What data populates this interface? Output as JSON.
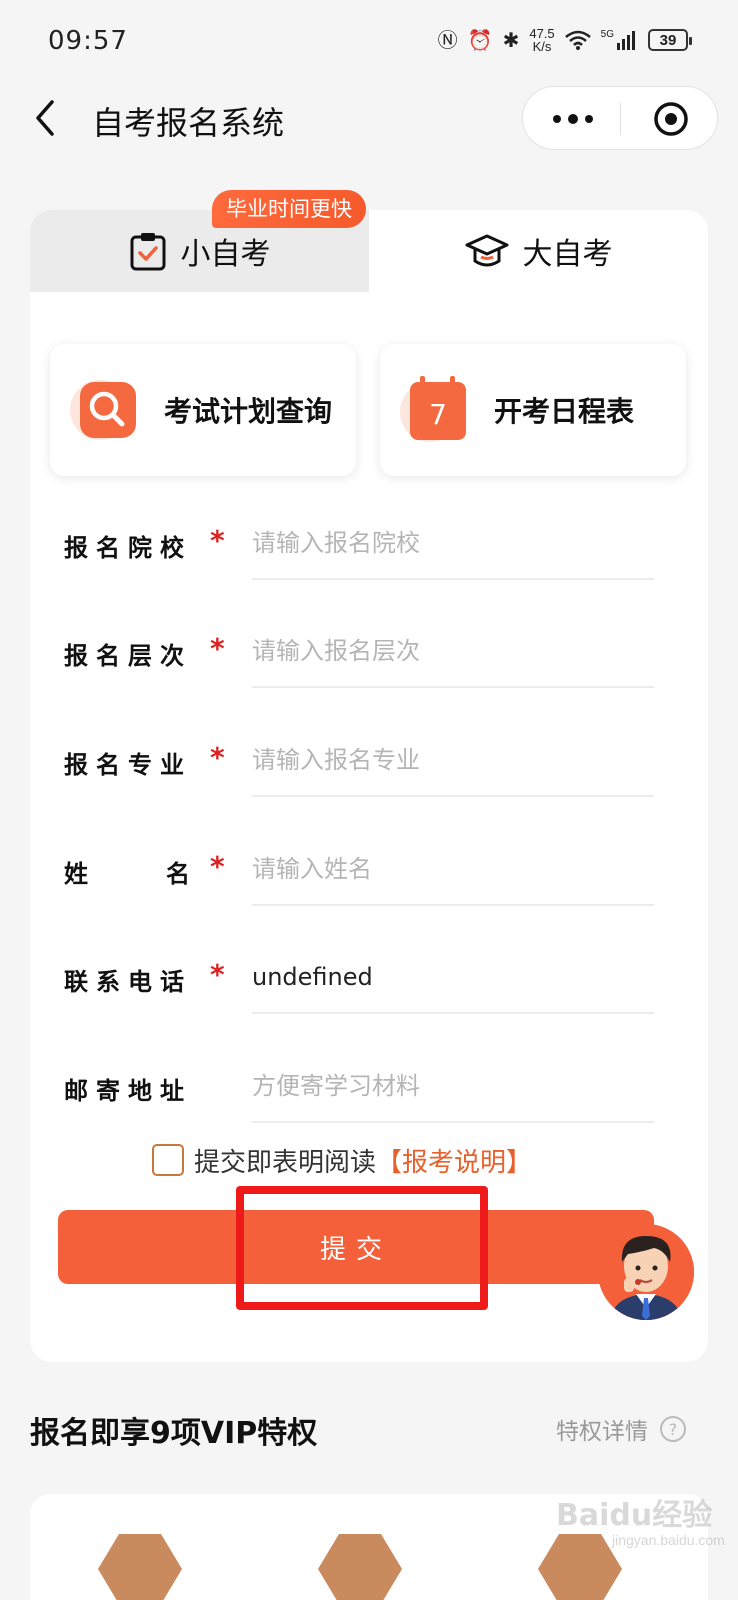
{
  "status_bar": {
    "time": "09:57",
    "net_speed_value": "47.5",
    "net_speed_unit": "K/s",
    "network": "5G",
    "battery": "39"
  },
  "nav": {
    "title": "自考报名系统"
  },
  "tabs": {
    "small_label": "小自考",
    "small_badge": "毕业时间更快",
    "big_label": "大自考"
  },
  "quick_actions": {
    "plan_label": "考试计划查询",
    "schedule_label": "开考日程表",
    "schedule_icon_number": "7"
  },
  "form": {
    "school": {
      "label": "报名院校",
      "placeholder": "请输入报名院校",
      "required": "*"
    },
    "level": {
      "label": "报名层次",
      "placeholder": "请输入报名层次",
      "required": "*"
    },
    "major": {
      "label": "报名专业",
      "placeholder": "请输入报名专业",
      "required": "*"
    },
    "name": {
      "label_a": "姓",
      "label_b": "名",
      "placeholder": "请输入姓名",
      "required": "*"
    },
    "phone": {
      "label": "联系电话",
      "value": "undefined",
      "required": "*"
    },
    "address": {
      "label": "邮寄地址",
      "placeholder": "方便寄学习材料"
    }
  },
  "agreement": {
    "text": "提交即表明阅读",
    "link": "【报考说明】"
  },
  "submit_label": "提交",
  "vip": {
    "title": "报名即享9项VIP特权",
    "detail_label": "特权详情",
    "help_symbol": "?"
  },
  "watermark": {
    "main": "Baidu经验",
    "sub": "jingyan.baidu.com"
  },
  "colors": {
    "accent": "#f4603a",
    "required": "#e02020",
    "highlight": "#ee1a1a",
    "link": "#e8612c"
  }
}
